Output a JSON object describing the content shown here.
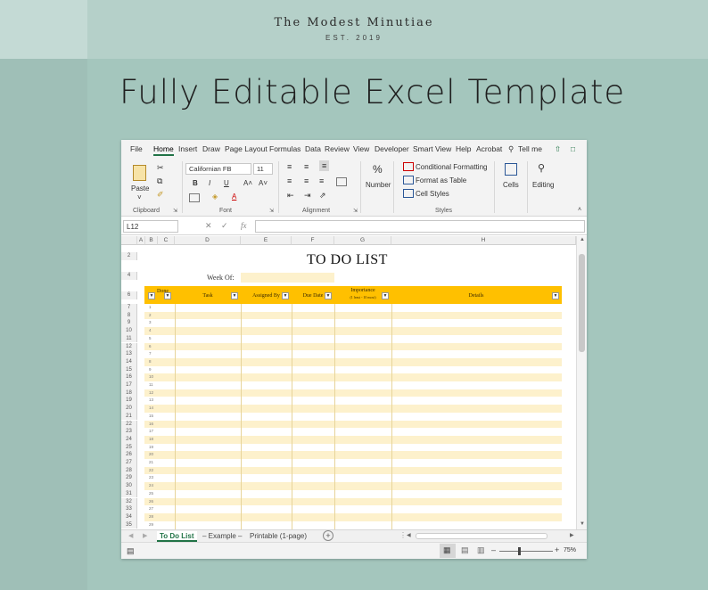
{
  "brand": {
    "name": "The Modest Minutiae",
    "established": "EST. 2019"
  },
  "headline": "Fully Editable Excel Template",
  "excel": {
    "menu": [
      "File",
      "Home",
      "Insert",
      "Draw",
      "Page Layout",
      "Formulas",
      "Data",
      "Review",
      "View",
      "Developer",
      "Smart View",
      "Help",
      "Acrobat"
    ],
    "active_menu": "Home",
    "tell_me": "Tell me",
    "ribbon": {
      "clipboard": {
        "label": "Clipboard",
        "paste": "Paste"
      },
      "font": {
        "label": "Font",
        "name": "Californian FB",
        "size": "11",
        "bold": "B",
        "italic": "I",
        "underline": "U",
        "grow": "A˄",
        "shrink": "A˅"
      },
      "alignment": {
        "label": "Alignment"
      },
      "number": {
        "label": "Number",
        "symbol": "%"
      },
      "styles": {
        "label": "Styles",
        "conditional": "Conditional Formatting",
        "format_table": "Format as Table",
        "cell_styles": "Cell Styles"
      },
      "cells": {
        "label": "Cells"
      },
      "editing": {
        "label": "Editing"
      }
    },
    "name_box": "L12",
    "fx": "fx",
    "columns": [
      "A",
      "B",
      "C",
      "D",
      "E",
      "F",
      "G",
      "H"
    ],
    "rows": [
      "2",
      "4",
      "6",
      "7",
      "8",
      "9",
      "10",
      "11",
      "12",
      "13",
      "14",
      "15",
      "16",
      "17",
      "18",
      "19",
      "20",
      "21",
      "22",
      "23",
      "24",
      "25",
      "26",
      "27",
      "28",
      "29",
      "30",
      "31",
      "32",
      "33",
      "34",
      "35"
    ],
    "sheet": {
      "title": "TO DO LIST",
      "week_of": "Week Of:",
      "headers": {
        "done": "Done",
        "task": "Task",
        "assigned_by": "Assigned By",
        "due_date": "Due Date",
        "importance": "Importance",
        "importance_sub": "(1 least - 10 most)",
        "details": "Details"
      },
      "row_numbers": [
        "1",
        "2",
        "3",
        "4",
        "5",
        "6",
        "7",
        "8",
        "9",
        "10",
        "11",
        "12",
        "13",
        "14",
        "15",
        "16",
        "17",
        "18",
        "19",
        "20",
        "21",
        "22",
        "23",
        "24",
        "25",
        "26",
        "27",
        "28",
        "29"
      ]
    },
    "tabs": [
      "To Do List",
      "– Example –",
      "Printable (1-page)"
    ],
    "active_tab": "To Do List",
    "zoom": "75%"
  },
  "colors": {
    "bg": "#a4c6bd",
    "header_gold": "#ffc000",
    "stripe": "#fdf1cc",
    "excel_green": "#217346"
  }
}
